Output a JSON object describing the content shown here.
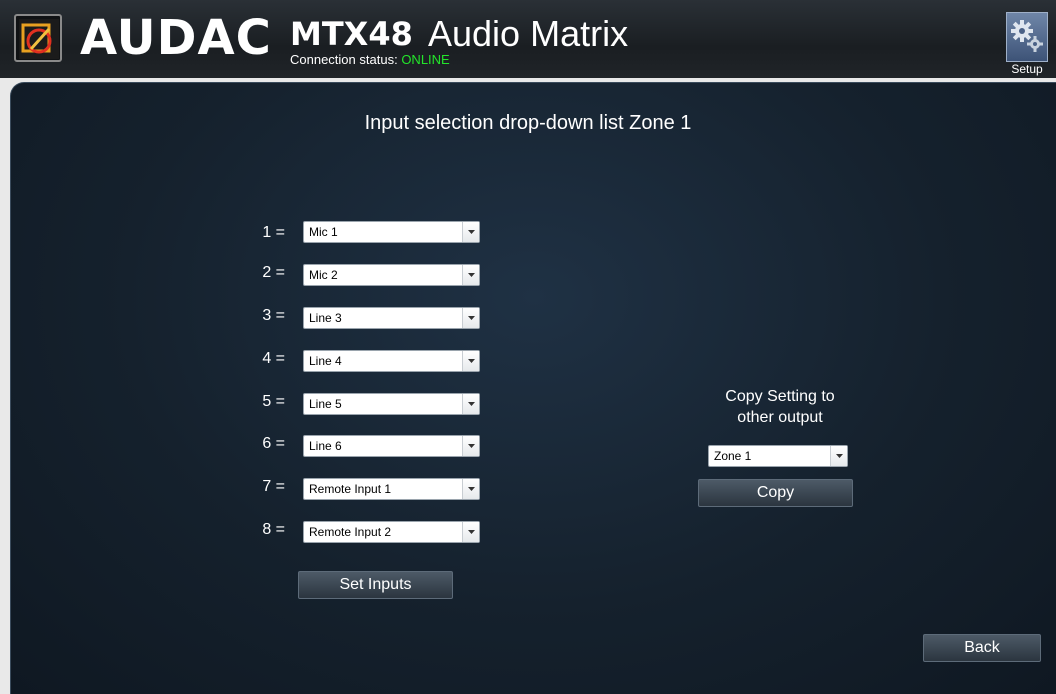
{
  "header": {
    "brand": "AUDAC",
    "model": "MTX48",
    "product": "Audio Matrix",
    "connection_label": "Connection status:",
    "connection_value": "ONLINE",
    "setup_label": "Setup",
    "colors": {
      "online": "#23e52a"
    }
  },
  "page": {
    "title": "Input selection drop-down list Zone 1"
  },
  "inputs": [
    {
      "label": "1 =",
      "value": "Mic 1"
    },
    {
      "label": "2 =",
      "value": "Mic 2"
    },
    {
      "label": "3 =",
      "value": "Line 3"
    },
    {
      "label": "4 =",
      "value": "Line 4"
    },
    {
      "label": "5 =",
      "value": "Line 5"
    },
    {
      "label": "6 =",
      "value": "Line 6"
    },
    {
      "label": "7 =",
      "value": "Remote Input 1"
    },
    {
      "label": "8 =",
      "value": "Remote Input 2"
    }
  ],
  "buttons": {
    "set_inputs": "Set Inputs",
    "copy": "Copy",
    "back": "Back"
  },
  "copy_section": {
    "line1": "Copy Setting to",
    "line2": "other output",
    "zone_select": "Zone 1"
  },
  "icons": {
    "logo": "audac-logo-icon",
    "setup": "gear-icon",
    "dropdown": "chevron-down-icon"
  }
}
